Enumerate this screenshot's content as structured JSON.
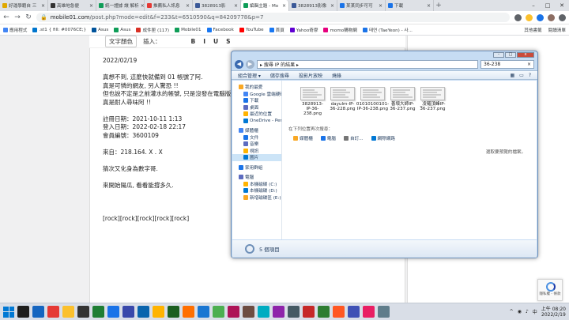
{
  "tabs": [
    {
      "label": "好運學籍自 三",
      "color": "#e0a800"
    },
    {
      "label": "高雄地急便",
      "color": "#333333"
    },
    {
      "label": "統一證據 讓 解析",
      "color": "#0f9d58"
    },
    {
      "label": "推薦私人訊息",
      "color": "#e53935"
    },
    {
      "label": "3828913影",
      "color": "#3b5998"
    },
    {
      "label": "編輯主題 - Mo",
      "color": "#0f9d58",
      "active": true
    },
    {
      "label": "3828913影像",
      "color": "#3b5998"
    },
    {
      "label": "某某同步可可",
      "color": "#1a73e8"
    },
    {
      "label": "下載",
      "color": "#1a73e8"
    }
  ],
  "new_tab": "+",
  "url": {
    "host": "mobile01.com",
    "path": "/post.php?mode=edit&f=233&t=6510590&q=84209778&p=7"
  },
  "bookmarks": [
    {
      "label": "應用程式",
      "color": "#4285f4"
    },
    {
      "label": ".st1 { fill: #0076CE;}",
      "color": "#0076ce"
    },
    {
      "label": "Asus",
      "color": "#00539b"
    },
    {
      "label": "Asus",
      "color": "#0f9d58"
    },
    {
      "label": "成件匣 (117)",
      "color": "#d93025"
    },
    {
      "label": "Mobile01",
      "color": "#0f9d58"
    },
    {
      "label": "Facebook",
      "color": "#1877f2"
    },
    {
      "label": "YouTube",
      "color": "#ff0000"
    },
    {
      "label": "首頁",
      "color": "#1877f2"
    },
    {
      "label": "Yahoo奇摩",
      "color": "#6001d2"
    },
    {
      "label": "momo購物網",
      "color": "#e6007e"
    },
    {
      "label": "태연 (TaeYeon) - 사...",
      "color": "#1a73e8"
    }
  ],
  "bookmarks_right": [
    "其他書籤",
    "閱讀清單"
  ],
  "editor": {
    "format_label": "文字顏色",
    "insert_label": "插入：",
    "tools": [
      "B",
      "I",
      "U",
      "S"
    ],
    "lines": [
      "2022/02/19",
      "",
      "真想不到, 這麼快就備到 01 帳號了阿.",
      "真是可憐的網友, 另人驚恐 !!",
      "但也說不定是之前灌水的帳號, 只是沒發在電腦版",
      "真是耐人尋味阿 !!",
      "",
      "註冊日期：2021-10-11 1:13",
      "登入日期：2022-02-18 22:17",
      "會員編號：3600109",
      "",
      "來自：218.164. X . X",
      "",
      "猜次又化身為數字哥.",
      "",
      "來開始陽瓜, 看看能撐多久.",
      "",
      "",
      "",
      "[rock][rock][rock][rock][rock]"
    ]
  },
  "explorer": {
    "title_buttons": [
      "-",
      "□",
      "x"
    ],
    "path": "▸ 搜尋 IP 的結果 ▸",
    "search_value": "36-238",
    "commands": [
      "組合管理 ▾",
      "儲存搜尋",
      "投影片放映",
      "燒錄"
    ],
    "nav_sections": [
      {
        "label": "我的最愛",
        "items": [
          "Google 雲端硬碟",
          "下載",
          "桌面",
          "最近的位置",
          "OneDrive - Persor"
        ]
      },
      {
        "label": "媒體櫃",
        "items": [
          "文件",
          "音樂",
          "視訊",
          "圖片"
        ]
      },
      {
        "label": "家用群組",
        "items": []
      },
      {
        "label": "電腦",
        "items": [
          "本機磁碟 (C:)",
          "本機磁碟 (D:)",
          "新增磁碟區 (E:)"
        ]
      }
    ],
    "files": [
      "3828913-IP-36-238.png",
      "dayulm-IP-36-228.png",
      "01010100101-IP-36-238.png",
      "善壞大師IP-36-237.png",
      "_凌羅頂峰IP-36-237.png"
    ],
    "search_again": "在下列位置再次搜尋：",
    "search_again_links": [
      "媒體櫃",
      "電腦",
      "自訂...",
      "網際網路"
    ],
    "preview_note": "選取要預覽的檔案。",
    "status": "5 個項目"
  },
  "captcha_text": "隱私權 - 條款",
  "clock": {
    "time": "上午 08:20",
    "date": "2022/2/19"
  },
  "taskbar_apps": [
    "#1e1e1e",
    "#1565c0",
    "#e53935",
    "#fbc02d",
    "#333333",
    "#1e7e34",
    "#1a73e8",
    "#3949ab",
    "#0a64ad",
    "#ffb300",
    "#1b5e20",
    "#ff6f00",
    "#1976d2",
    "#4caf50",
    "#ad1457",
    "#6d4c41",
    "#00acc1",
    "#8e24aa",
    "#455a64",
    "#c62828",
    "#2e7d32",
    "#ff5722",
    "#3f51b5",
    "#e91e63",
    "#607d8b"
  ]
}
